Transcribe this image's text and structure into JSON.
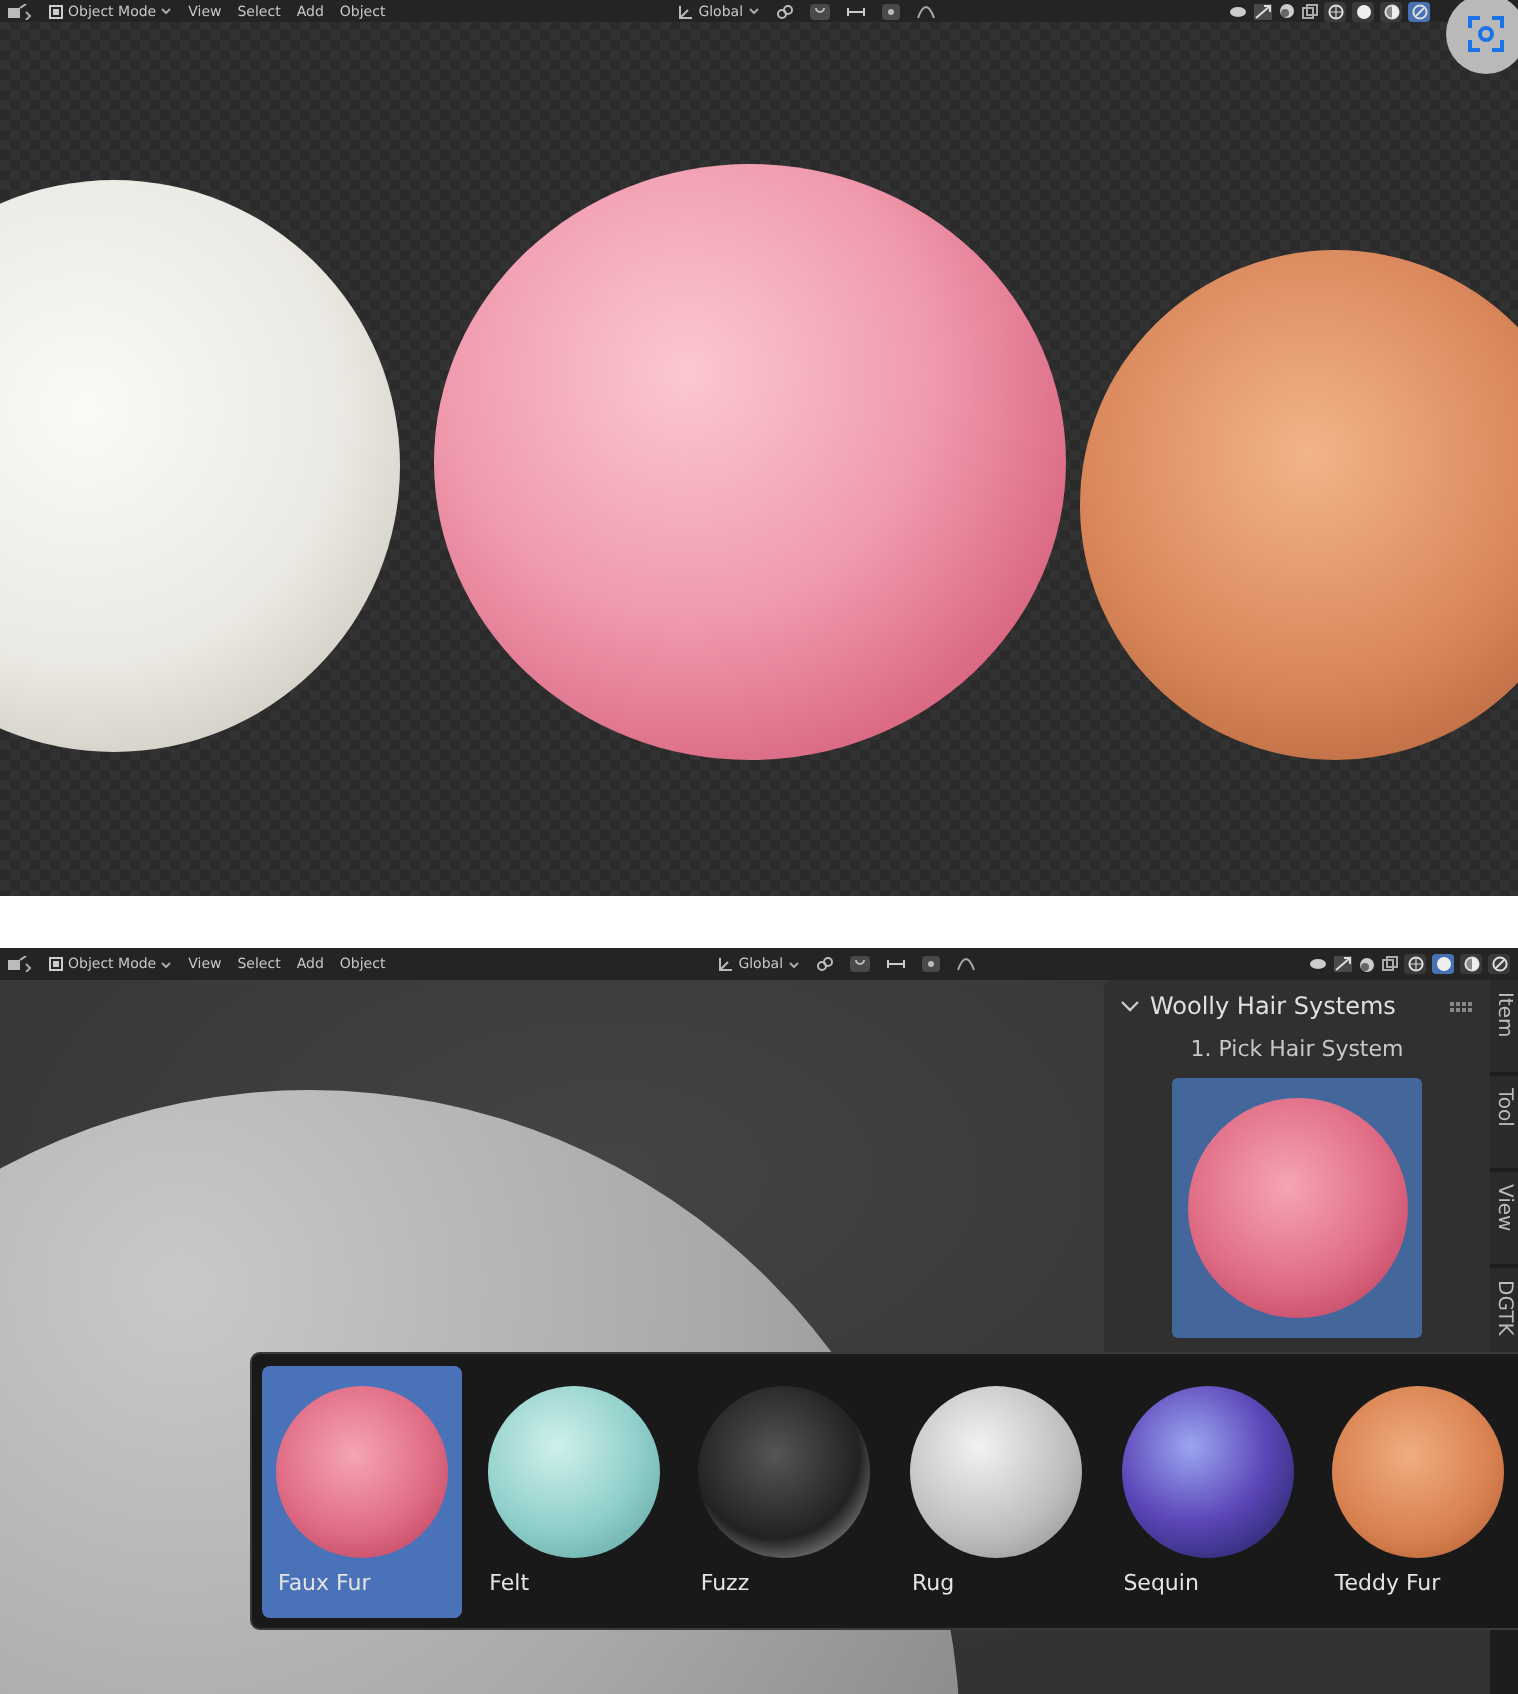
{
  "top_viewport": {
    "header": {
      "mode": "Object Mode",
      "menus": [
        "View",
        "Select",
        "Add",
        "Object"
      ],
      "orientation": "Global",
      "shading": [
        {
          "selected": false
        },
        {
          "selected": false
        },
        {
          "selected": false
        },
        {
          "selected": true
        }
      ]
    }
  },
  "bottom_viewport": {
    "header": {
      "mode": "Object Mode",
      "menus": [
        "View",
        "Select",
        "Add",
        "Object"
      ],
      "orientation": "Global",
      "shading": [
        {
          "selected": false
        },
        {
          "selected": true
        },
        {
          "selected": false
        },
        {
          "selected": false
        }
      ]
    },
    "panel": {
      "title": "Woolly Hair Systems",
      "expanded": true,
      "step_label": "1. Pick Hair System"
    },
    "side_tabs": [
      "Item",
      "Tool",
      "View",
      "DGTK"
    ],
    "hair_picker": [
      {
        "label": "Faux Fur",
        "selected": true
      },
      {
        "label": "Felt",
        "selected": false
      },
      {
        "label": "Fuzz",
        "selected": false
      },
      {
        "label": "Rug",
        "selected": false
      },
      {
        "label": "Sequin",
        "selected": false
      },
      {
        "label": "Teddy Fur",
        "selected": false
      }
    ]
  }
}
